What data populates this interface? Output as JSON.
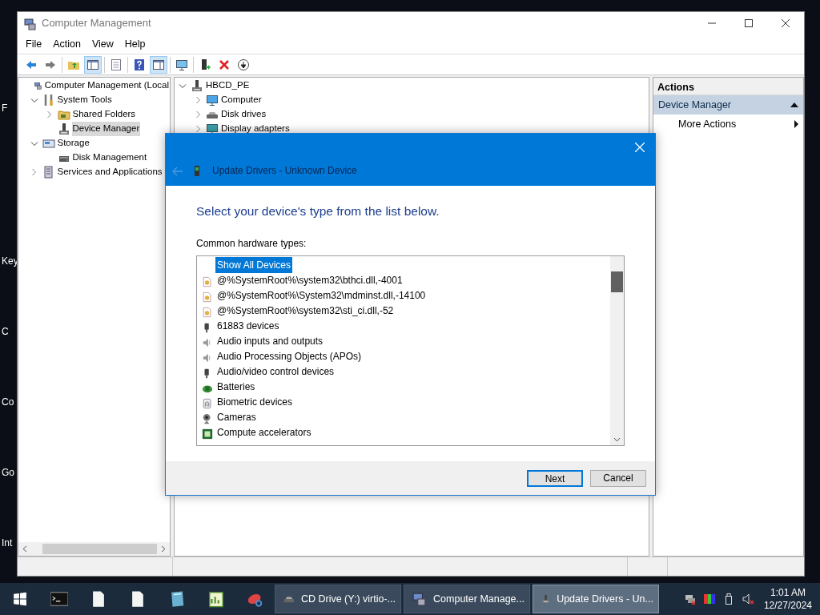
{
  "desktop_labels": [
    "F",
    "Key",
    "C",
    "Co",
    "Go",
    "Int"
  ],
  "window": {
    "title": "Computer Management"
  },
  "menu": [
    "File",
    "Action",
    "View",
    "Help"
  ],
  "toolbar": [
    [
      {
        "kind": "back",
        "pressed": false
      },
      {
        "kind": "forward",
        "pressed": false
      }
    ],
    [
      {
        "kind": "up",
        "pressed": false
      },
      {
        "kind": "tree",
        "pressed": true
      }
    ],
    [
      {
        "kind": "export",
        "pressed": false
      }
    ],
    [
      {
        "kind": "help",
        "pressed": false
      },
      {
        "kind": "pane",
        "pressed": true
      }
    ],
    [
      {
        "kind": "monitor",
        "pressed": false
      }
    ],
    [
      {
        "kind": "enable",
        "pressed": false
      },
      {
        "kind": "uninstall",
        "pressed": false
      },
      {
        "kind": "download",
        "pressed": false
      }
    ]
  ],
  "console_tree": [
    {
      "label": "Computer Management (Local",
      "kind": "mgmt",
      "selected": false,
      "children": [
        {
          "label": "System Tools",
          "kind": "tools",
          "selected": false,
          "expanded": true,
          "children": [
            {
              "label": "Shared Folders",
              "kind": "share",
              "selected": false,
              "expanded": false
            },
            {
              "label": "Device Manager",
              "kind": "device",
              "selected": true
            }
          ]
        },
        {
          "label": "Storage",
          "kind": "storage",
          "selected": false,
          "expanded": true,
          "children": [
            {
              "label": "Disk Management",
              "kind": "disk",
              "selected": false
            }
          ]
        },
        {
          "label": "Services and Applications",
          "kind": "services",
          "selected": false,
          "expanded": false
        }
      ]
    }
  ],
  "device_tree": [
    {
      "label": "HBCD_PE",
      "kind": "device",
      "expanded": true,
      "children": [
        {
          "label": "Computer",
          "kind": "computer",
          "expanded": false
        },
        {
          "label": "Disk drives",
          "kind": "drive",
          "expanded": false
        },
        {
          "label": "Display adapters",
          "kind": "display",
          "expanded": false
        }
      ]
    }
  ],
  "actions": {
    "title": "Actions",
    "sections": [
      {
        "title": "Device Manager",
        "expanded": true,
        "items": [
          {
            "label": "More Actions",
            "submenu": true
          }
        ]
      }
    ]
  },
  "dialog": {
    "title": "Update Drivers - Unknown Device",
    "back_enabled": false,
    "heading": "Select your device's type from the list below.",
    "list_label": "Common hardware types:",
    "items": [
      {
        "label": "Show All Devices",
        "kind": "none",
        "selected": true
      },
      {
        "label": "@%SystemRoot%\\system32\\bthci.dll,-4001",
        "kind": "file",
        "selected": false
      },
      {
        "label": "@%SystemRoot%\\System32\\mdminst.dll,-14100",
        "kind": "file",
        "selected": false
      },
      {
        "label": "@%SystemRoot%\\system32\\sti_ci.dll,-52",
        "kind": "file",
        "selected": false
      },
      {
        "label": "61883 devices",
        "kind": "plug",
        "selected": false
      },
      {
        "label": "Audio inputs and outputs",
        "kind": "speaker",
        "selected": false
      },
      {
        "label": "Audio Processing Objects (APOs)",
        "kind": "speaker",
        "selected": false
      },
      {
        "label": "Audio/video control devices",
        "kind": "plug",
        "selected": false
      },
      {
        "label": "Batteries",
        "kind": "battery",
        "selected": false
      },
      {
        "label": "Biometric devices",
        "kind": "fingerprint",
        "selected": false
      },
      {
        "label": "Cameras",
        "kind": "camera",
        "selected": false
      },
      {
        "label": "Compute accelerators",
        "kind": "chip",
        "selected": false
      }
    ],
    "buttons": [
      {
        "label": "Next",
        "default": true
      },
      {
        "label": "Cancel",
        "default": false
      }
    ]
  },
  "taskbar": {
    "pinned": [
      {
        "kind": "cmd"
      },
      {
        "kind": "document"
      },
      {
        "kind": "document"
      },
      {
        "kind": "notebook"
      },
      {
        "kind": "spreadsheet"
      },
      {
        "kind": "snip"
      }
    ],
    "tasks": [
      {
        "label": "CD Drive (Y:) virtio-...",
        "kind": "drive",
        "selected": false
      },
      {
        "label": "Computer Manage...",
        "kind": "mgmt",
        "selected": false
      },
      {
        "label": "Update Drivers - Un...",
        "kind": "device",
        "selected": true
      }
    ],
    "tray": [
      {
        "kind": "network"
      },
      {
        "kind": "color"
      },
      {
        "kind": "usb"
      },
      {
        "kind": "volume"
      }
    ],
    "time": "1:01 AM",
    "date": "12/27/2024"
  }
}
